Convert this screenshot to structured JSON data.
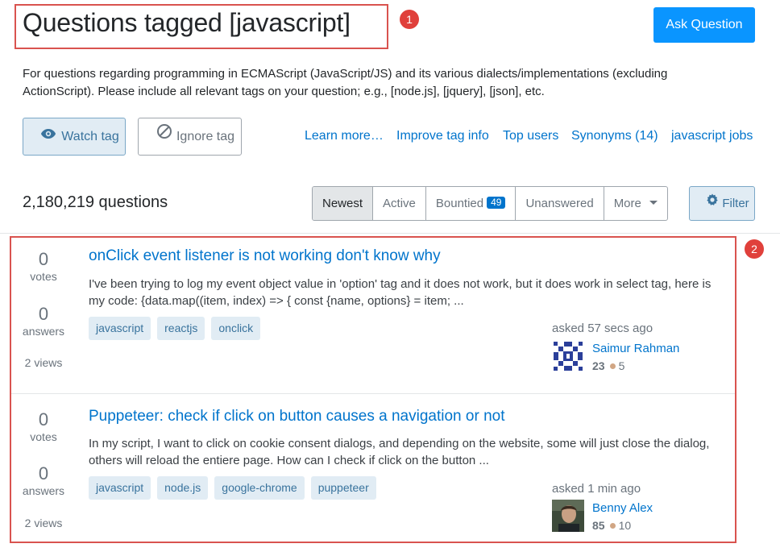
{
  "header": {
    "title": "Questions tagged [javascript]",
    "ask_button": "Ask Question",
    "annotation_1": "1",
    "annotation_2": "2"
  },
  "tag_info": {
    "description": "For questions regarding programming in ECMAScript (JavaScript/JS) and its various dialects/implementations (excluding ActionScript). Please include all relevant tags on your question; e.g., [node.js], [jquery], [json], etc.",
    "watch_label": "Watch tag",
    "ignore_label": "Ignore tag",
    "links": [
      "Learn more…",
      "Improve tag info",
      "Top users",
      "Synonyms (14)",
      "javascript jobs"
    ]
  },
  "listing": {
    "count_text": "2,180,219 questions",
    "sort_tabs": [
      {
        "label": "Newest",
        "active": true
      },
      {
        "label": "Active"
      },
      {
        "label": "Bountied",
        "badge": "49"
      },
      {
        "label": "Unanswered"
      },
      {
        "label": "More"
      }
    ],
    "filter_label": "Filter"
  },
  "questions": [
    {
      "votes": "0",
      "votes_label": "votes",
      "answers": "0",
      "answers_label": "answers",
      "views": "2 views",
      "title": "onClick event listener is not working don't know why",
      "excerpt": "I've been trying to log my event object value in 'option' tag and it does not work, but it does work in select tag, here is my code: {data.map((item, index) => { const {name, options} = item; ...",
      "tags": [
        "javascript",
        "reactjs",
        "onclick"
      ],
      "asked": "asked 57 secs ago",
      "user": {
        "name": "Saimur Rahman",
        "rep": "23",
        "bronze": "5",
        "avatar": "identicon-blue"
      }
    },
    {
      "votes": "0",
      "votes_label": "votes",
      "answers": "0",
      "answers_label": "answers",
      "views": "2 views",
      "title": "Puppeteer: check if click on button causes a navigation or not",
      "excerpt": "In my script, I want to click on cookie consent dialogs, and depending on the website, some will just close the dialog, others will reload the entiere page. How can I check if click on the button ...",
      "tags": [
        "javascript",
        "node.js",
        "google-chrome",
        "puppeteer"
      ],
      "asked": "asked 1 min ago",
      "user": {
        "name": "Benny Alex",
        "rep": "85",
        "bronze": "10",
        "avatar": "photo"
      }
    }
  ],
  "colors": {
    "accent": "#0a95ff",
    "link": "#0074cc",
    "tag_bg": "#e1ecf4",
    "annotation": "#d9534f"
  }
}
